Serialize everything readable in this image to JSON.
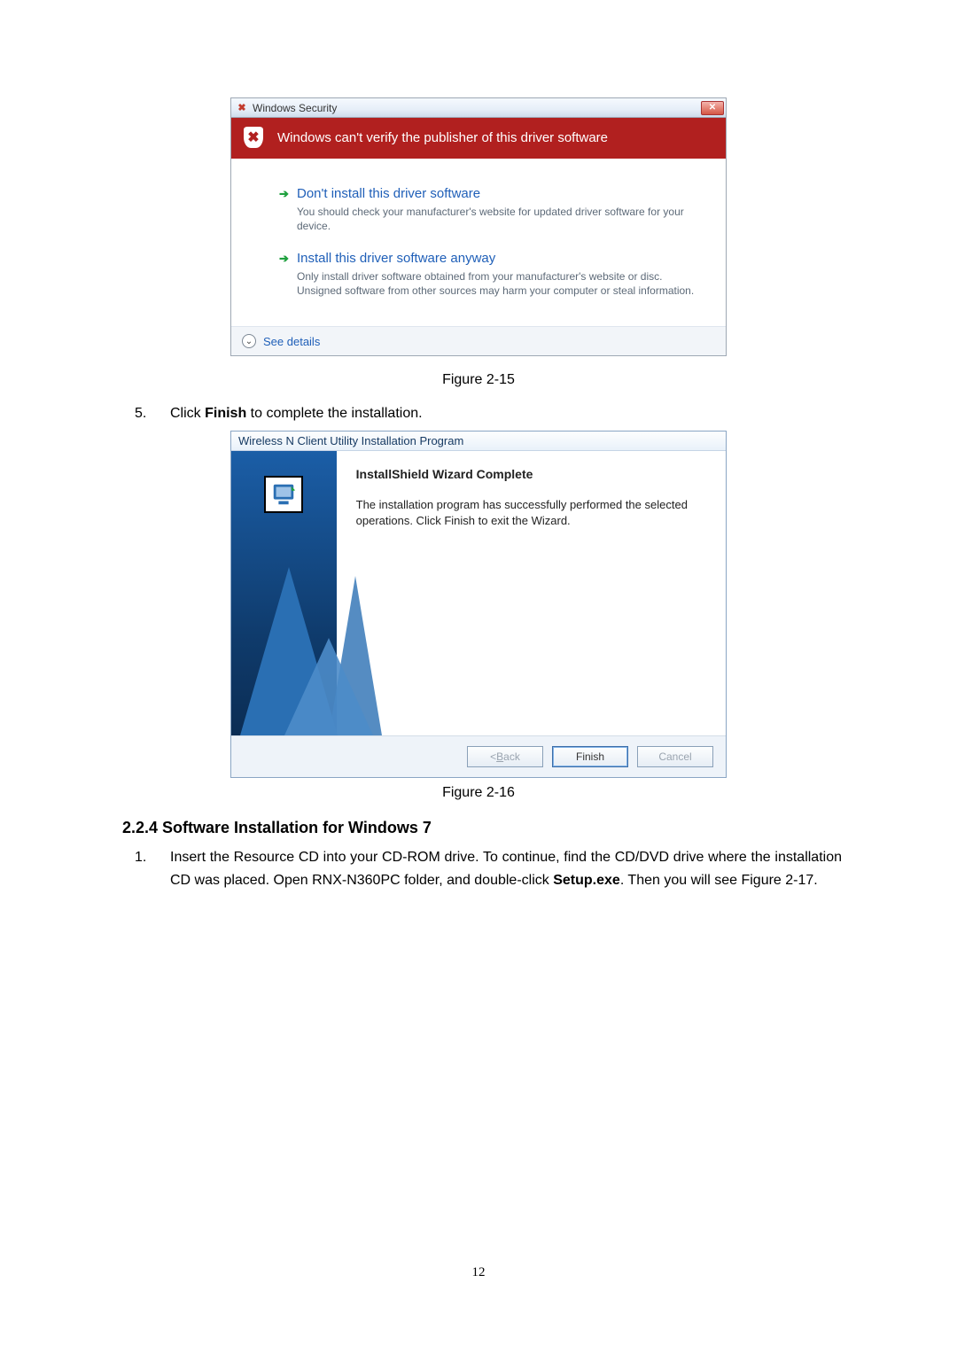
{
  "security_dialog": {
    "window_title": "Windows Security",
    "headline": "Windows can't verify the publisher of this driver software",
    "option1": {
      "title": "Don't install this driver software",
      "desc": "You should check your manufacturer's website for updated driver software for your device."
    },
    "option2": {
      "title": "Install this driver software anyway",
      "desc": "Only install driver software obtained from your manufacturer's website or disc. Unsigned software from other sources may harm your computer or steal information."
    },
    "see_details": "See details"
  },
  "figure15_caption": "Figure 2-15",
  "step5": {
    "num": "5.",
    "text_before": "Click ",
    "bold": "Finish",
    "text_after": " to complete the installation."
  },
  "wizard": {
    "window_title": "Wireless N Client Utility Installation Program",
    "heading": "InstallShield Wizard Complete",
    "desc": "The installation program has successfully performed the selected operations.  Click Finish to exit the Wizard.",
    "back_prefix": "< ",
    "back_u": "B",
    "back_suffix": "ack",
    "finish": "Finish",
    "cancel": "Cancel"
  },
  "figure16_caption": "Figure 2-16",
  "section_heading": "2.2.4  Software Installation for Windows 7",
  "step1": {
    "num": "1.",
    "text_a": "Insert the Resource CD into your CD-ROM drive. To continue, find the CD/DVD drive where the installation CD was placed. Open RNX-N360PC folder, and double-click ",
    "bold": "Setup.exe",
    "text_b": ". Then you will see Figure 2-17."
  },
  "page_number": "12"
}
